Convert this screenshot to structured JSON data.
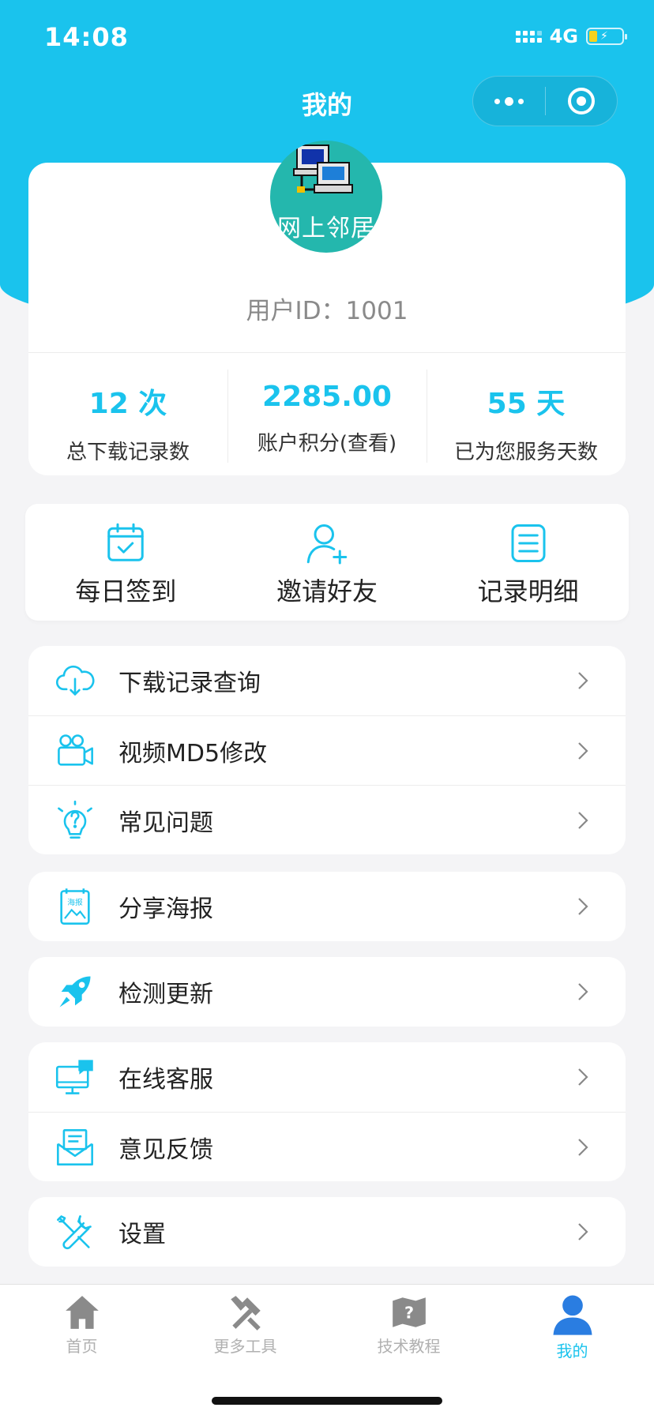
{
  "status_bar": {
    "time": "14:08",
    "network": "4G",
    "battery_color": "#f7d21e"
  },
  "nav": {
    "title": "我的"
  },
  "theme": {
    "accent": "#1ac3ed"
  },
  "profile": {
    "avatar_text": "网上邻居",
    "user_id": "用户ID：1001",
    "stats": [
      {
        "value": "12 次",
        "label": "总下载记录数"
      },
      {
        "value": "2285.00",
        "label": "账户积分(查看)"
      },
      {
        "value": "55 天",
        "label": "已为您服务天数"
      }
    ]
  },
  "quick_actions": [
    {
      "label": "每日签到",
      "icon": "calendar-check-icon"
    },
    {
      "label": "邀请好友",
      "icon": "add-user-icon"
    },
    {
      "label": "记录明细",
      "icon": "list-icon"
    }
  ],
  "menu_groups": [
    [
      {
        "label": "下载记录查询",
        "icon": "cloud-download-icon"
      },
      {
        "label": "视频MD5修改",
        "icon": "video-camera-icon"
      },
      {
        "label": "常见问题",
        "icon": "lightbulb-question-icon"
      }
    ],
    [
      {
        "label": "分享海报",
        "icon": "poster-icon",
        "icon_text": "海报"
      }
    ],
    [
      {
        "label": "检测更新",
        "icon": "rocket-icon"
      }
    ],
    [
      {
        "label": "在线客服",
        "icon": "monitor-chat-icon"
      },
      {
        "label": "意见反馈",
        "icon": "envelope-icon"
      }
    ],
    [
      {
        "label": "设置",
        "icon": "wrench-icon"
      }
    ]
  ],
  "tabbar": [
    {
      "label": "首页",
      "icon": "home-icon",
      "active": false
    },
    {
      "label": "更多工具",
      "icon": "tools-icon",
      "active": false
    },
    {
      "label": "技术教程",
      "icon": "tutorial-map-icon",
      "active": false
    },
    {
      "label": "我的",
      "icon": "user-icon",
      "active": true
    }
  ]
}
